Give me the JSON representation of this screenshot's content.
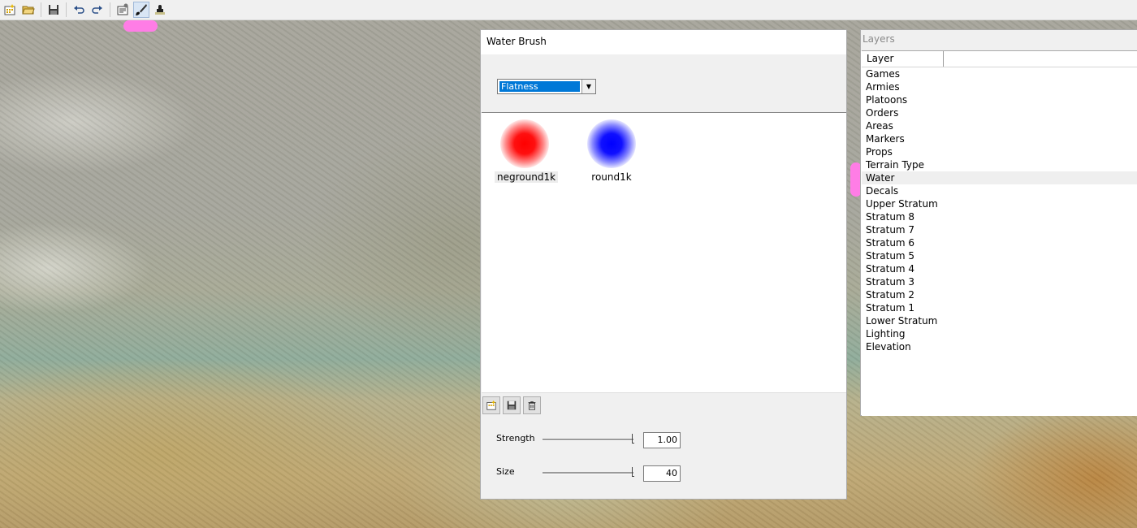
{
  "toolbar": {
    "buttons": [
      {
        "icon": "new-map-icon"
      },
      {
        "icon": "open-folder-icon"
      },
      {
        "icon": "save-disk-icon"
      },
      {
        "icon": "undo-icon"
      },
      {
        "icon": "redo-icon"
      },
      {
        "icon": "properties-icon"
      },
      {
        "icon": "brush-icon",
        "active": true
      },
      {
        "icon": "stamp-icon"
      }
    ]
  },
  "brush_panel": {
    "title": "Water Brush",
    "mode_select": {
      "value": "Flatness"
    },
    "brushes": [
      {
        "label": "neground1k",
        "color": "#ff0000",
        "selected": true
      },
      {
        "label": "round1k",
        "color": "#0000ff",
        "selected": false
      }
    ],
    "strength": {
      "label": "Strength",
      "value": "1.00",
      "level": 1.0
    },
    "size": {
      "label": "Size",
      "value": "40",
      "level": 1.0
    }
  },
  "layers_panel": {
    "title": "Layers",
    "column_header": "Layer",
    "selected": "Water",
    "items": [
      "Games",
      "Armies",
      "Platoons",
      "Orders",
      "Areas",
      "Markers",
      "Props",
      "Terrain Type",
      "Water",
      "Decals",
      "Upper Stratum",
      "Stratum 8",
      "Stratum 7",
      "Stratum 6",
      "Stratum 5",
      "Stratum 4",
      "Stratum 3",
      "Stratum 2",
      "Stratum 1",
      "Lower Stratum",
      "Lighting",
      "Elevation"
    ]
  },
  "colors": {
    "highlight_marker": "#ff7de6",
    "select_highlight": "#0078d7"
  }
}
